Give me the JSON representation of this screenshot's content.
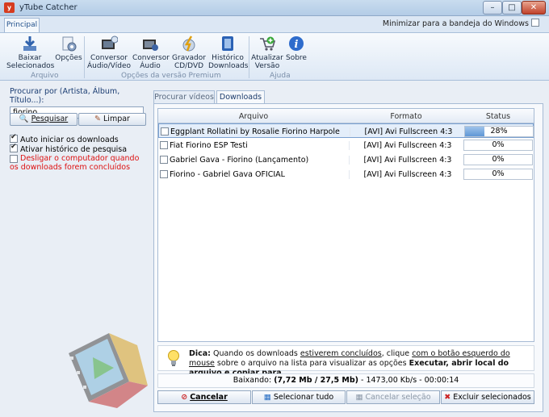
{
  "window": {
    "title": "yTube Catcher"
  },
  "ribbon_tabs": {
    "principal": "Principal"
  },
  "minimize_option": {
    "label": "Minimizar para a bandeja do Windows",
    "checked": false
  },
  "ribbon": {
    "buttons": [
      {
        "l1": "Baixar",
        "l2": "Selecionados"
      },
      {
        "l1": "Opções",
        "l2": ""
      },
      {
        "l1": "Conversor",
        "l2": "Áudio/Vídeo"
      },
      {
        "l1": "Conversor",
        "l2": "Áudio"
      },
      {
        "l1": "Gravador",
        "l2": "CD/DVD"
      },
      {
        "l1": "Histórico",
        "l2": "Downloads"
      },
      {
        "l1": "Atualizar",
        "l2": "Versão"
      },
      {
        "l1": "Sobre",
        "l2": ""
      }
    ],
    "groups": {
      "arquivo": "Arquivo",
      "premium": "Opções da versão Premium",
      "ajuda": "Ajuda"
    }
  },
  "search": {
    "label": "Procurar por (Artista, Álbum, Título...):",
    "value": "fiorino",
    "search_button": "Pesquisar",
    "clear_button": "Limpar"
  },
  "options": {
    "auto_start": "Auto iniciar os downloads",
    "history": "Ativar histórico de pesquisa",
    "shutdown": "Desligar o computador quando os downloads forem concluídos"
  },
  "tabs": {
    "search_videos": "Procurar vídeos",
    "downloads": "Downloads"
  },
  "grid": {
    "headers": {
      "file": "Arquivo",
      "format": "Formato",
      "status": "Status"
    },
    "rows": [
      {
        "name": "Eggplant Rollatini by Rosalie Fiorino Harpole",
        "format": "[AVI] Avi Fullscreen 4:3",
        "status": "28%",
        "progress": 0.28
      },
      {
        "name": "Fiat Fiorino ESP Testi",
        "format": "[AVI] Avi Fullscreen 4:3",
        "status": "0%",
        "progress": 0
      },
      {
        "name": "Gabriel Gava - Fiorino (Lançamento)",
        "format": "[AVI] Avi Fullscreen 4:3",
        "status": "0%",
        "progress": 0
      },
      {
        "name": "Fiorino - Gabriel Gava OFICIAL",
        "format": "[AVI] Avi Fullscreen 4:3",
        "status": "0%",
        "progress": 0
      }
    ]
  },
  "tip": {
    "label": "Dica:",
    "t1": " Quando os downloads ",
    "u1": "estiverem concluídos",
    "t2": ", clique ",
    "u2": "com o botão esquerdo do mouse",
    "t3": " sobre o arquivo na lista para visualizar as opções ",
    "b1": "Executar, abrir local do arquivo e copiar para",
    "t4": "."
  },
  "download_status": {
    "prefix": "Baixando: ",
    "sizes": "(7,72 Mb / 27,5 Mb)",
    "rest": " - 1473,00 Kb/s - 00:00:14"
  },
  "bottom_buttons": {
    "cancel": "Cancelar",
    "select_all": "Selecionar tudo",
    "cancel_selection": "Cancelar seleção",
    "delete_selected": "Excluir selecionados"
  }
}
